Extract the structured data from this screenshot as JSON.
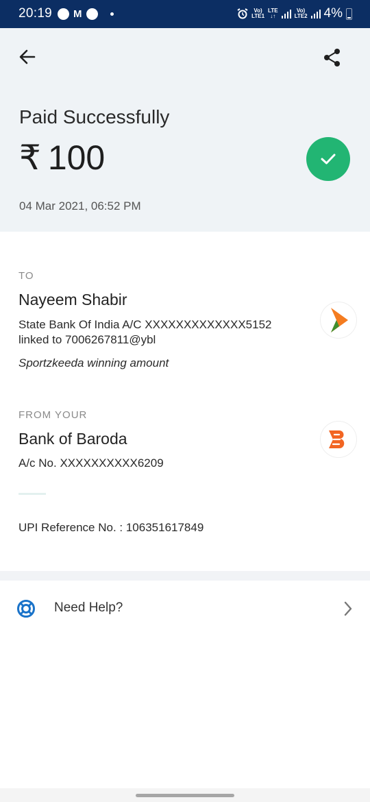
{
  "status_bar": {
    "time": "20:19",
    "mail_icon": "M",
    "net1_top": "Vo)",
    "net1_bottom": "LTE1",
    "net_mid_top": "LTE",
    "net_mid_bottom": "↓↑",
    "net2_top": "Vo)",
    "net2_bottom": "LTE2",
    "battery": "4%"
  },
  "header": {
    "title": "Paid Successfully",
    "currency_symbol": "₹",
    "amount": "100",
    "datetime": "04 Mar 2021, 06:52 PM",
    "icons": {
      "back": "back-arrow-icon",
      "share": "share-icon",
      "success": "check-icon"
    },
    "colors": {
      "success": "#22b573",
      "background": "#eff3f6"
    }
  },
  "to": {
    "label": "TO",
    "name": "Nayeem  Shabir",
    "account": "State Bank Of India A/C XXXXXXXXXXXXX5152",
    "linked": "linked to 7006267811@ybl",
    "note": "Sportzkeeda winning amount"
  },
  "from": {
    "label": "FROM YOUR",
    "bank": "Bank of Baroda",
    "account": "A/c No. XXXXXXXXXX6209"
  },
  "upi_reference": "UPI Reference No. : 106351617849",
  "help": {
    "label": "Need Help?",
    "icons": {
      "lifebuoy": "lifebuoy-icon",
      "chevron": "chevron-right-icon"
    }
  },
  "colors": {
    "status_bar": "#0c2e63",
    "accent": "#1a73c9",
    "sbi": "#f47c20",
    "bob": "#f26522"
  }
}
